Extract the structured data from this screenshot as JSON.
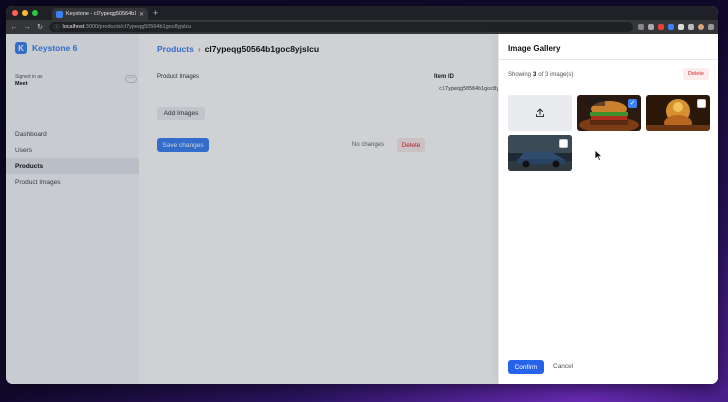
{
  "browser": {
    "tab_title": "Keystone - cl7ypeqg50564b1goc8yjslcu",
    "url_host": "localhost",
    "url_path": ":3000/products/cl7ypeqg50564b1goc8yjslcu"
  },
  "sidebar": {
    "brand": "Keystone 6",
    "brand_logo": "K",
    "signed_in_label": "Signed in as",
    "user": "Meet",
    "more_label": "···",
    "items": [
      {
        "label": "Dashboard",
        "active": false
      },
      {
        "label": "Users",
        "active": false
      },
      {
        "label": "Products",
        "active": true
      },
      {
        "label": "Product Images",
        "active": false
      }
    ]
  },
  "main": {
    "breadcrumb_link": "Products",
    "breadcrumb_sep": "›",
    "breadcrumb_current": "cl7ypeqg50564b1goc8yjslcu",
    "field_label": "Product Images",
    "add_button": "Add Images",
    "save_button": "Save changes",
    "no_changes": "No changes",
    "delete_button": "Delete",
    "item_id_label": "Item ID",
    "item_id_value": "cl7ypeqg50564b1goc8yjslcu"
  },
  "drawer": {
    "title": "Image Gallery",
    "count_prefix": "Showing",
    "count_shown": "3",
    "count_suffix": "of 3 image(s)",
    "delete_button": "Delete",
    "images": [
      {
        "name": "burger",
        "checked": true
      },
      {
        "name": "festival",
        "checked": false
      },
      {
        "name": "car",
        "checked": false
      }
    ],
    "confirm_button": "Confirm",
    "cancel_button": "Cancel"
  },
  "colors": {
    "accent": "#3b82f6",
    "danger": "#dc2626"
  }
}
